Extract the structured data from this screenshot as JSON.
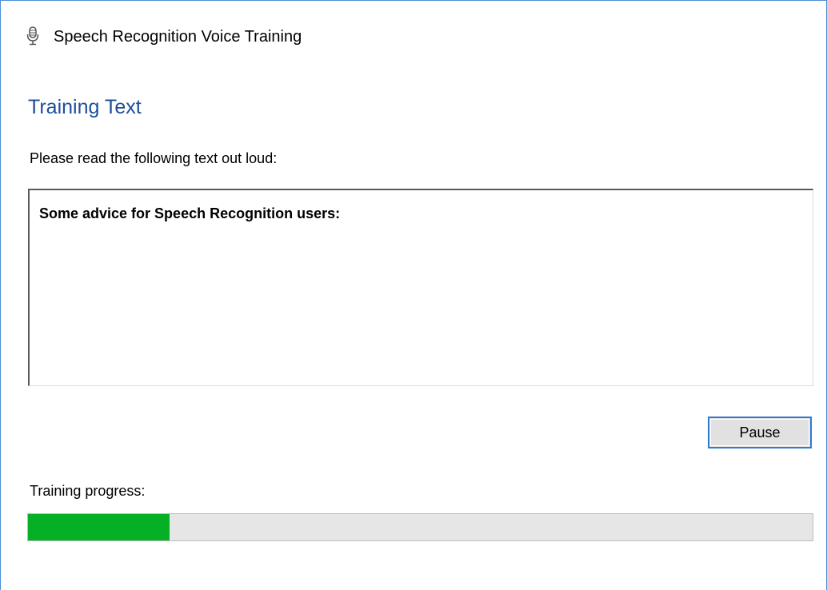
{
  "window": {
    "title": "Speech Recognition Voice Training",
    "icon": "microphone-icon"
  },
  "page": {
    "heading": "Training Text",
    "instruction": "Please read the following text out loud:"
  },
  "training_text": {
    "content": "Some advice for Speech Recognition users:"
  },
  "buttons": {
    "pause_label": "Pause"
  },
  "progress": {
    "label": "Training progress:",
    "fraction": 0.18,
    "fill_color": "#06b025"
  },
  "colors": {
    "heading": "#1f4e9b",
    "window_border": "#4a8fd6",
    "button_focus_border": "#2f7bd3"
  }
}
